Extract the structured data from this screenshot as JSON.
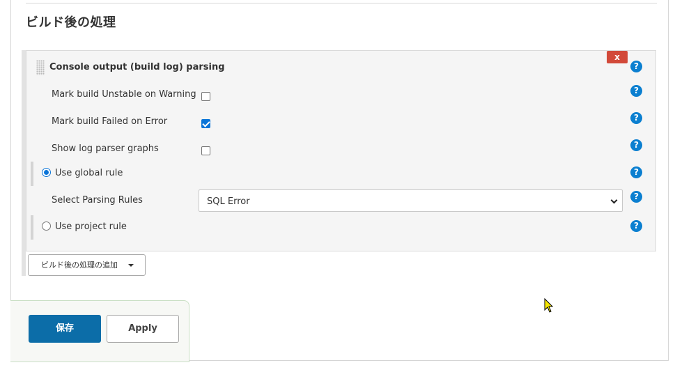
{
  "section": {
    "title": "ビルド後の処理"
  },
  "step": {
    "title": "Console output (build log) parsing",
    "delete_label": "x",
    "options": [
      {
        "label": "Mark build Unstable on Warning",
        "checked": false
      },
      {
        "label": "Mark build Failed on Error",
        "checked": true
      },
      {
        "label": "Show log parser graphs",
        "checked": false
      }
    ],
    "global_rule": {
      "label": "Use global rule",
      "selected": true
    },
    "parsing_rules": {
      "label": "Select Parsing Rules",
      "value": "SQL Error"
    },
    "project_rule": {
      "label": "Use project rule",
      "selected": false
    }
  },
  "help_glyph": "?",
  "add_button": {
    "label": "ビルド後の処理の追加"
  },
  "footer": {
    "save_label": "保存",
    "apply_label": "Apply"
  },
  "colors": {
    "primary": "#0c6da8",
    "help": "#0b7fd0",
    "delete": "#d24939",
    "checkbox": "#0b75d8"
  }
}
